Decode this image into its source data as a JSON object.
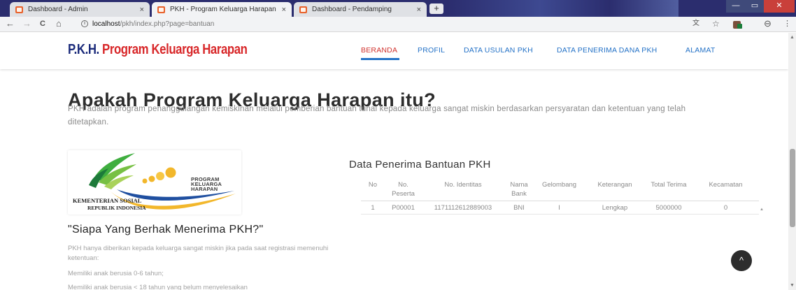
{
  "browser": {
    "tabs": [
      {
        "title": "Dashboard - Admin",
        "close": "×"
      },
      {
        "title": "PKH - Program Keluarga Harapan",
        "close": "×"
      },
      {
        "title": "Dashboard - Pendamping",
        "close": "×"
      }
    ],
    "new_tab": "+",
    "window": {
      "minimize": "—",
      "maximize": "▭",
      "close": "✕"
    },
    "nav": {
      "back": "←",
      "forward": "→",
      "reload": "C",
      "home": "⌂"
    },
    "url": {
      "host": "localhost",
      "path": "/pkh/index.php?page=bantuan"
    }
  },
  "site": {
    "brand": {
      "short": "P.K.H.",
      "full": "Program Keluarga Harapan"
    },
    "menu": [
      {
        "label": "BERANDA",
        "active": true
      },
      {
        "label": "PROFIL",
        "active": false
      },
      {
        "label": "DATA USULAN PKH",
        "active": false
      },
      {
        "label": "DATA PENERIMA DANA PKH",
        "active": false
      },
      {
        "label": "ALAMAT",
        "active": false
      }
    ],
    "accent_color": "#2472c7",
    "active_color": "#d0312d"
  },
  "main": {
    "heading": "Apakah Program Keluarga Harapan itu?",
    "intro": "PKH adalah program penanggulangan kemiskinan melalui pemberian bantuan tunai kepada keluarga sangat miskin berdasarkan persyaratan dan ketentuan yang telah ditetapkan.",
    "logo": {
      "org_line1": "KEMENTERIAN SOSIAL",
      "org_line2": "REPUBLIK INDONESIA",
      "pkh_lines": [
        "PROGRAM",
        "KELUARGA",
        "HARAPAN"
      ]
    },
    "subheading": "\"Siapa Yang Berhak Menerima PKH?\"",
    "paragraphs": [
      "PKH hanya diberikan kepada keluarga sangat miskin jika pada saat registrasi memenuhi ketentuan:",
      "Memiliki anak berusia 0-6 tahun;",
      "Memiliki anak berusia < 18 tahun yang belum menyelesaikan"
    ]
  },
  "table": {
    "title": "Data Penerima Bantuan PKH",
    "headers": [
      "No",
      "No. Peserta",
      "No. Identitas",
      "Nama Bank",
      "Gelombang",
      "Keterangan",
      "Total Terima",
      "Kecamatan"
    ],
    "rows": [
      [
        "1",
        "P00001",
        "1171112612889003",
        "BNI",
        "I",
        "Lengkap",
        "5000000",
        "0"
      ]
    ]
  },
  "back_to_top": "^"
}
